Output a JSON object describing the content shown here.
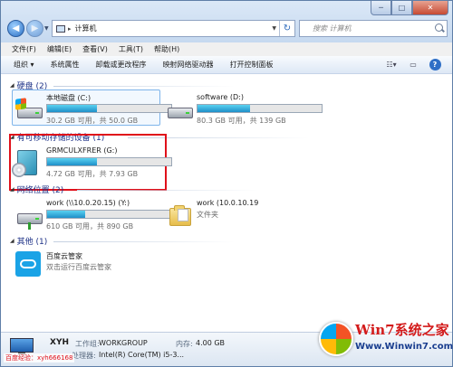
{
  "window": {
    "controls": {
      "minimize": "─",
      "maximize": "□",
      "close": "✕"
    }
  },
  "nav": {
    "back": "◀",
    "forward": "▶"
  },
  "address": {
    "path": "计算机"
  },
  "search": {
    "placeholder": "搜索 计算机"
  },
  "menu": [
    "文件(F)",
    "编辑(E)",
    "查看(V)",
    "工具(T)",
    "帮助(H)"
  ],
  "toolbar": {
    "items": [
      "组织 ▾",
      "系统属性",
      "卸载或更改程序",
      "映射网络驱动器",
      "打开控制面板"
    ],
    "help": "?"
  },
  "groups": {
    "hard_disks": {
      "title": "硬盘 (2)",
      "drives": [
        {
          "name": "本地磁盘 (C:)",
          "info": "30.2 GB 可用，共 50.0 GB",
          "fill": 0.4
        },
        {
          "name": "software (D:)",
          "info": "80.3 GB 可用，共 139 GB",
          "fill": 0.42
        }
      ]
    },
    "removable": {
      "title": "有可移动存储的设备 (1)",
      "drives": [
        {
          "name": "GRMCULXFRER (G:)",
          "info": "4.72 GB 可用，共 7.93 GB",
          "fill": 0.4
        }
      ]
    },
    "network": {
      "title": "网络位置 (2)",
      "drives": [
        {
          "name": "work (\\\\10.0.20.15) (Y:)",
          "info": "610 GB 可用，共 890 GB",
          "fill": 0.31
        },
        {
          "name": "work (10.0.10.19",
          "sub": "文件夹"
        }
      ]
    },
    "other": {
      "title": "其他 (1)",
      "items": [
        {
          "name": "百度云管家",
          "sub": "双击运行百度云管家"
        }
      ]
    }
  },
  "details": {
    "name": "XYH",
    "workgroup_label": "工作组:",
    "workgroup": "WORKGROUP",
    "memory_label": "内存:",
    "memory": "4.00 GB",
    "cpu_label": "处理器:",
    "cpu": "Intel(R) Core(TM) i5-3..."
  },
  "watermark": {
    "badge": "百度经验：xyh666168",
    "site_title": "Win7系统之家",
    "site_url": "Www.Winwin7.com"
  }
}
